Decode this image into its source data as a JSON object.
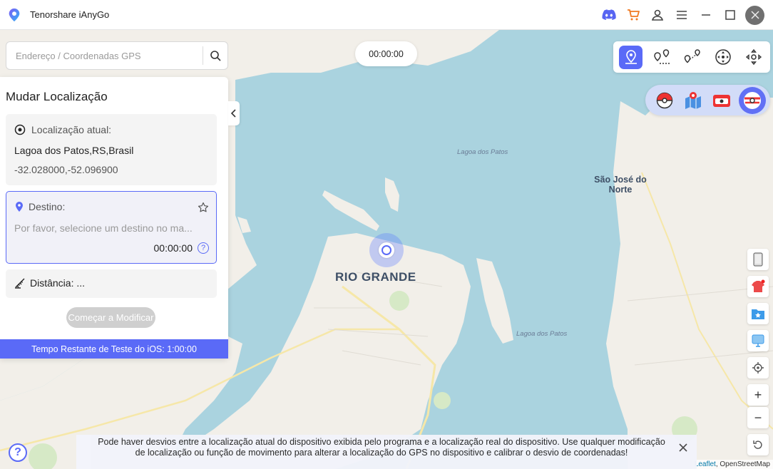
{
  "window": {
    "title": "Tenorshare iAnyGo"
  },
  "search": {
    "placeholder": "Endereço / Coordenadas GPS"
  },
  "timer": "00:00:00",
  "panel": {
    "title": "Mudar Localização",
    "current": {
      "label": "Localização atual:",
      "place": "Lagoa dos Patos,RS,Brasil",
      "coords": "-32.028000,-52.096900"
    },
    "destination": {
      "label": "Destino:",
      "placeholder": "Por favor, selecione um destino no ma...",
      "time": "00:00:00"
    },
    "distance": {
      "label": "Distância: ..."
    },
    "start_button": "Começar a Modificar",
    "trial": "Tempo Restante de Teste do iOS: 1:00:00"
  },
  "map": {
    "labels": {
      "lagoa_1": "Lagoa dos Patos",
      "lagoa_2": "Lagoa dos Patos",
      "city_main": "RIO GRANDE",
      "city_side": "São José do Norte"
    },
    "attribution": {
      "leaflet": "Leaflet",
      "osm": ", OpenStreetMap"
    },
    "colors": {
      "water": "#aad3df",
      "land": "#f2efe9",
      "accent": "#5a6af7"
    }
  },
  "notice": {
    "text": "Pode haver desvios entre a localização atual do dispositivo exibida pelo programa e a localização real do dispositivo. Use qualquer modificação de localização ou função de movimento para alterar a localização do GPS no dispositivo e calibrar o desvio de coordenadas!"
  },
  "zoom": {
    "in": "+",
    "out": "−"
  },
  "help": "?"
}
